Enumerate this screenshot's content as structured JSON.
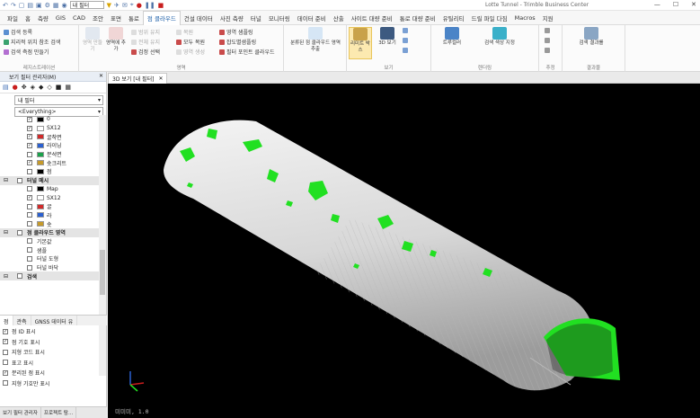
{
  "app": {
    "title": "Lotte Tunnel - Trimble Business Center",
    "qat_view_filter": "내 필터"
  },
  "menu": [
    "파일",
    "홈",
    "측량",
    "GIS",
    "CAD",
    "조안",
    "표면",
    "통로",
    "점 클라우드",
    "건설 데이터",
    "사진 측량",
    "터널",
    "모니터링",
    "데이터 준비",
    "산출",
    "사이트 대량 준비",
    "통로 대량 준비",
    "유틸리티",
    "드릴 파일 다짐",
    "Macros",
    "지원"
  ],
  "menu_active": "점 클라우드",
  "ribbon": {
    "col1": [
      "검색 등록",
      "지리적 위치 참조 검색",
      "검색 측점 만들기"
    ],
    "col1_group": "레지스트레이션",
    "btn_region_create": "영역 만들기",
    "btn_region_add": "영역에 추가",
    "col2": [
      "범위 유지",
      "전체 유지",
      "검정 선택"
    ],
    "col3": [
      "복원",
      "모두 복원",
      "영역 생성"
    ],
    "col4": [
      "영역 샘플링",
      "잡도별샘플링",
      "필터 포인트 클라우드"
    ],
    "region_group": "영역",
    "btn_split": "분류된 점 클라우드 영역 추출",
    "btn_limitbox": "리미트 박스",
    "btn_3dview": "3D 보기",
    "view_group": "보기",
    "btn_trunk": "트루컬러",
    "btn_scan_color": "검색 색상 지정",
    "render_group": "렌더링",
    "extract_group": "추정",
    "btn_scan_result": "검색 결과를",
    "result_group": "결과물"
  },
  "left_panel": {
    "title": "보기 필터 관리자(M)",
    "filter_select": "내 필터",
    "everything_select": "<Everything>",
    "layers": [
      {
        "label": "0",
        "checked": true,
        "color": "#000000"
      },
      {
        "label": "SX12",
        "checked": true,
        "color": "#ffffff"
      },
      {
        "label": "굴착면",
        "checked": true,
        "color": "#d12a2a"
      },
      {
        "label": "라이닝",
        "checked": true,
        "color": "#2a60d1"
      },
      {
        "label": "분석면",
        "checked": false,
        "color": "#1aa24b"
      },
      {
        "label": "숏크리트",
        "checked": true,
        "color": "#c69a2a"
      },
      {
        "label": "점",
        "checked": false,
        "color": "#000000"
      }
    ],
    "section_tunnel_mesh": "터널 메시",
    "mesh_items": [
      {
        "label": "Map",
        "checked": false,
        "color": "#000000"
      },
      {
        "label": "SX12",
        "checked": true,
        "color": "#ffffff"
      },
      {
        "label": "굴",
        "checked": false,
        "color": "#d12a2a"
      },
      {
        "label": "라",
        "checked": false,
        "color": "#2a60d1"
      },
      {
        "label": "숏",
        "checked": false,
        "color": "#c69a2a"
      }
    ],
    "section_pointcloud_region": "점 클라우드 영역",
    "region_items": [
      {
        "label": "기본값",
        "checked": false
      },
      {
        "label": "샘플",
        "checked": false
      },
      {
        "label": "터널 도형",
        "checked": false
      },
      {
        "label": "터널 바닥",
        "checked": false
      }
    ],
    "section_scan": "검색",
    "tabs": [
      "점",
      "관측",
      "GNSS 데이터 유"
    ],
    "options": [
      {
        "label": "점 ID 표시",
        "checked": true
      },
      {
        "label": "점 기호 표시",
        "checked": true
      },
      {
        "label": "지형 코드 표시",
        "checked": false
      },
      {
        "label": "표고 표시",
        "checked": false
      },
      {
        "label": "분리된 점 표시",
        "checked": true
      },
      {
        "label": "지형 기호만 표시",
        "checked": false
      }
    ],
    "bottom_tabs": [
      "보기 필터 관리자",
      "프로젝트 탐..."
    ]
  },
  "view": {
    "tab_label": "3D 보기 [내 필터]",
    "status": "미미미, 1.0"
  },
  "colors": {
    "accent": "#1d5fa8",
    "tunnel_surface": "#d9d9d9",
    "patch_green": "#21e021",
    "viewport_bg": "#000000"
  }
}
